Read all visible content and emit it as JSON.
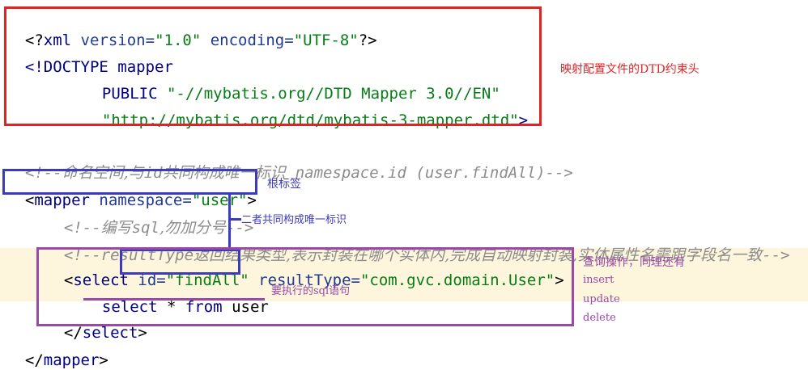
{
  "code": {
    "line1": {
      "pi_open": "<?",
      "xml": "xml",
      "attr1": " version=",
      "val1": "\"1.0\"",
      "attr2": " encoding=",
      "val2": "\"UTF-8\"",
      "pi_close": "?>"
    },
    "line2": {
      "open": "<!DOCTYPE ",
      "name": "mapper"
    },
    "line3": {
      "kw": "PUBLIC ",
      "value": "\"-//mybatis.org//DTD Mapper 3.0//EN\""
    },
    "line4": {
      "value": "\"http://mybatis.org/dtd/mybatis-3-mapper.dtd\"",
      "close": ">"
    },
    "line5": {
      "open": "<!--",
      "cn": "命名空间,与",
      "id": "id",
      "cn2": "共同构成唯一标识  ",
      "tail": "namespace.id (user.findAll)-->"
    },
    "line6": {
      "lt": "<",
      "tag": "mapper",
      "attr": " namespace=",
      "val": "\"user\"",
      "gt": ">"
    },
    "line7": {
      "open": "<!--",
      "cn": "编写",
      "sql": "sql",
      "cn2": ",勿加分号",
      "close": "-->"
    },
    "line8": {
      "open": "<!--",
      "rt": "resultType",
      "cn": "返回结果类型,表示封装在哪个实体内,完成自动映射封装,实体属性名需跟字段名一致",
      "close": "-->"
    },
    "line9": {
      "lt": "<",
      "tag": "select",
      "attr1": " id=",
      "val1": "\"findAll\"",
      "attr2": " resultType=",
      "val2": "\"com.gvc.domain.User\"",
      "gt": ">"
    },
    "line10": {
      "select": "select",
      "star": " * ",
      "from": "from",
      "table": " user"
    },
    "line11": {
      "lt": "</",
      "tag": "select",
      "gt": ">"
    },
    "line12": {
      "lt": "</",
      "tag": "mapper",
      "gt": ">"
    }
  },
  "annotations": {
    "dtd_header": "映射配置文件的DTD约束头",
    "root_tag": "根标签",
    "unique_id": "二者共同构成唯一标识",
    "sql_statement": "要执行的sql语句",
    "query_op": "查询操作，同理还有",
    "ops": [
      "insert",
      "update",
      "delete"
    ]
  },
  "colors": {
    "red_box": "#e02424",
    "blue_box": "#3b3bbf",
    "purple_box": "#9a4aa6",
    "highlight": "#fdf5dc"
  }
}
